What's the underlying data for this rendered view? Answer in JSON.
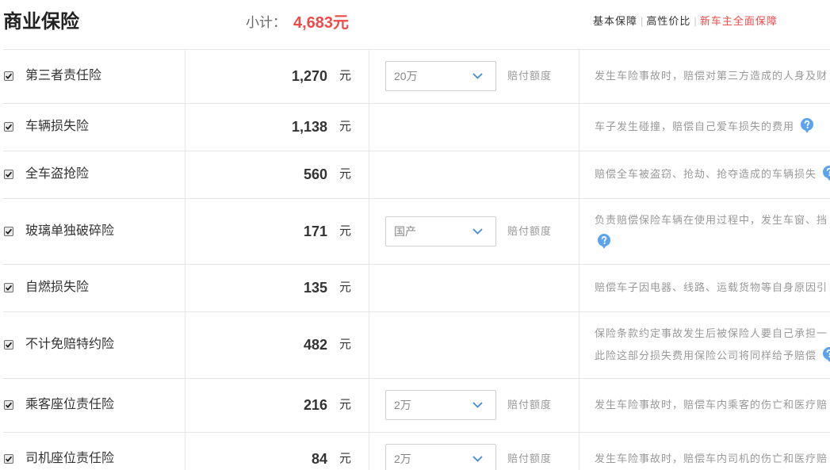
{
  "header": {
    "title": "商业保险",
    "subtotal": {
      "label": "小计：",
      "value": "4,683元"
    },
    "plan_tabs": [
      {
        "label": "基本保障",
        "active": false
      },
      {
        "label": "高性价比",
        "active": false
      },
      {
        "label": "新车主全面保障",
        "active": true
      }
    ],
    "separator": "|"
  },
  "colors": {
    "accent_red": "#ee4a4a",
    "help_icon_blue": "#5ba3ee",
    "chevron_blue": "#3d8ede",
    "muted_text": "#999999",
    "border": "#e6e6e6"
  },
  "rows": [
    {
      "name": "第三者责任险",
      "checked": true,
      "price": "1,270",
      "unit": "元",
      "coverage": {
        "value": "20万",
        "label": "赔付额度"
      },
      "description": [
        "发生车险事故时，赔偿对第三方造成的人身及财"
      ],
      "help_icon": null
    },
    {
      "name": "车辆损失险",
      "checked": true,
      "price": "1,138",
      "unit": "元",
      "coverage": null,
      "description": [
        "车子发生碰撞，赔偿自己爱车损失的费用"
      ],
      "help_icon": "question-icon"
    },
    {
      "name": "全车盗抢险",
      "checked": true,
      "price": "560",
      "unit": "元",
      "coverage": null,
      "description": [
        "赔偿全车被盗窃、抢劫、抢夺造成的车辆损失"
      ],
      "help_icon": "question-icon"
    },
    {
      "name": "玻璃单独破碎险",
      "checked": true,
      "price": "171",
      "unit": "元",
      "coverage": {
        "value": "国产",
        "label": "赔付额度"
      },
      "description": [
        "负责赔偿保险车辆在使用过程中，发生车窗、挡"
      ],
      "help_icon": "question-icon"
    },
    {
      "name": "自燃损失险",
      "checked": true,
      "price": "135",
      "unit": "元",
      "coverage": null,
      "description": [
        "赔偿车子因电器、线路、运载货物等自身原因引"
      ],
      "help_icon": null
    },
    {
      "name": "不计免赔特约险",
      "checked": true,
      "price": "482",
      "unit": "元",
      "coverage": null,
      "description": [
        "保险条款约定事故发生后被保险人要自己承担一",
        "此险这部分损失费用保险公司将同样给予赔偿"
      ],
      "help_icon": "question-icon"
    },
    {
      "name": "乘客座位责任险",
      "checked": true,
      "price": "216",
      "unit": "元",
      "coverage": {
        "value": "2万",
        "label": "赔付额度"
      },
      "description": [
        "发生车险事故时，赔偿车内乘客的伤亡和医疗赔"
      ],
      "help_icon": null
    },
    {
      "name": "司机座位责任险",
      "checked": true,
      "price": "84",
      "unit": "元",
      "coverage": {
        "value": "2万",
        "label": "赔付额度"
      },
      "description": [
        "发生车险事故时，赔偿车内司机的伤亡和医疗赔"
      ],
      "help_icon": null
    }
  ]
}
